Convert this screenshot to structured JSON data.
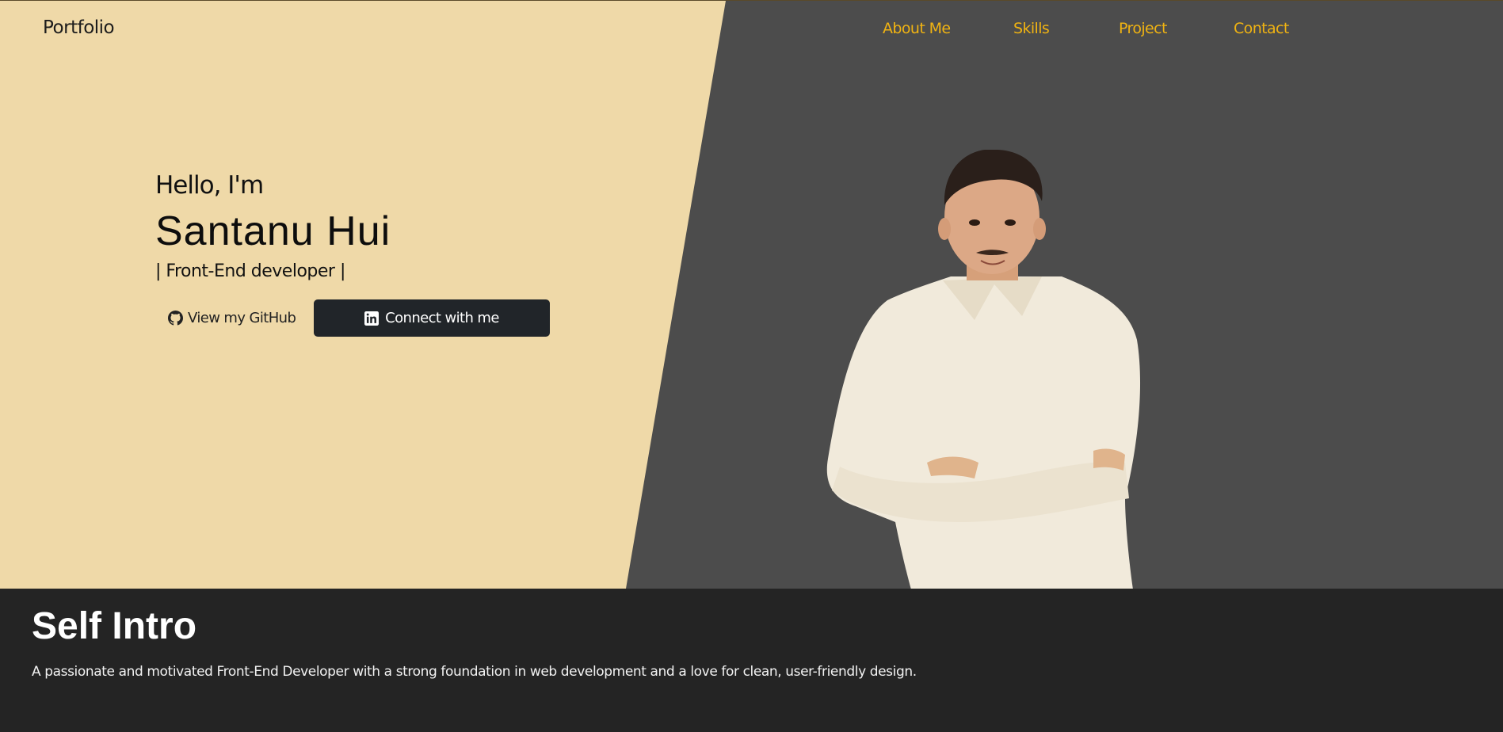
{
  "header": {
    "brand": "Portfolio",
    "nav": [
      {
        "label": "About Me"
      },
      {
        "label": "Skills"
      },
      {
        "label": "Project"
      },
      {
        "label": "Contact"
      }
    ]
  },
  "hero": {
    "greeting": "Hello, I'm",
    "name": "Santanu Hui",
    "role": "| Front-End developer |",
    "buttons": {
      "github": {
        "label": "View my GitHub",
        "icon": "github-icon"
      },
      "linkedin": {
        "label": "Connect with me",
        "icon": "linkedin-icon"
      }
    },
    "portrait": "profile-photo"
  },
  "about": {
    "title": "Self Intro",
    "text": "A passionate and motivated Front-End Developer with a strong foundation in web development and a love for clean, user-friendly design."
  },
  "colors": {
    "hero_left": "#efd9a8",
    "hero_right": "#4c4c4c",
    "nav_link": "#f0b312",
    "section_bg": "#242424",
    "button_dark": "#212529"
  }
}
